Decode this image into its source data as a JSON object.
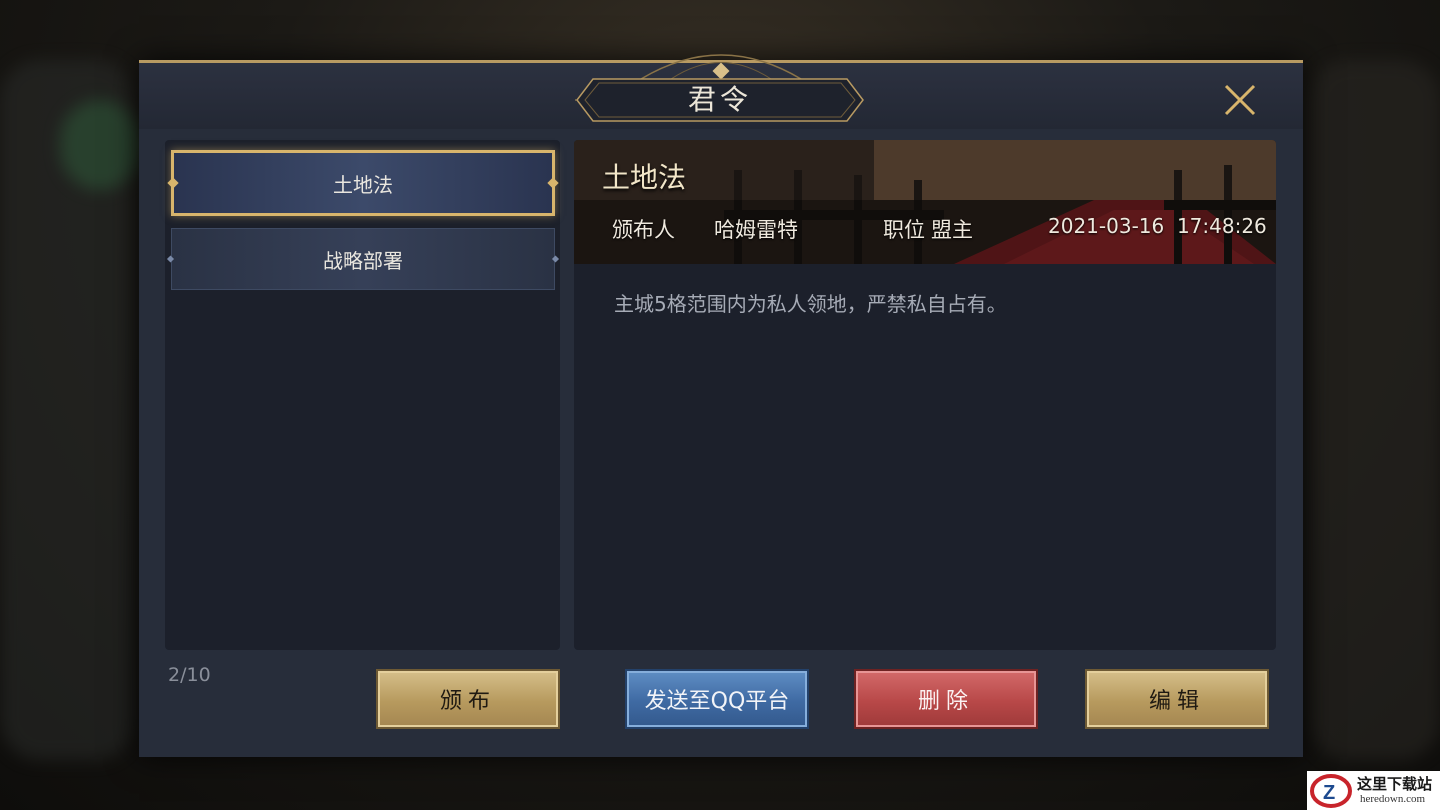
{
  "dialog": {
    "title": "君令"
  },
  "list": {
    "items": [
      {
        "label": "土地法",
        "selected": true
      },
      {
        "label": "战略部署",
        "selected": false
      }
    ],
    "page_count": "2/10"
  },
  "detail": {
    "title": "土地法",
    "publisher_label": "颁布人",
    "publisher_name": "哈姆雷特",
    "position_label": "职位",
    "position_value": "盟主",
    "timestamp": "2021-03-16  17:48:26",
    "body": "主城5格范围内为私人领地，严禁私自占有。"
  },
  "buttons": {
    "publish": "颁布",
    "send_qq": "发送至QQ平台",
    "delete": "删除",
    "edit": "编辑"
  },
  "watermark": {
    "title": "这里下载站",
    "url": "heredown.com"
  },
  "colors": {
    "accent_gold": "#d8b56c",
    "panel_bg": "#1c202b",
    "dialog_bg": "#272d3a",
    "delete_red": "#b84848",
    "qq_blue": "#3f6aa3"
  }
}
